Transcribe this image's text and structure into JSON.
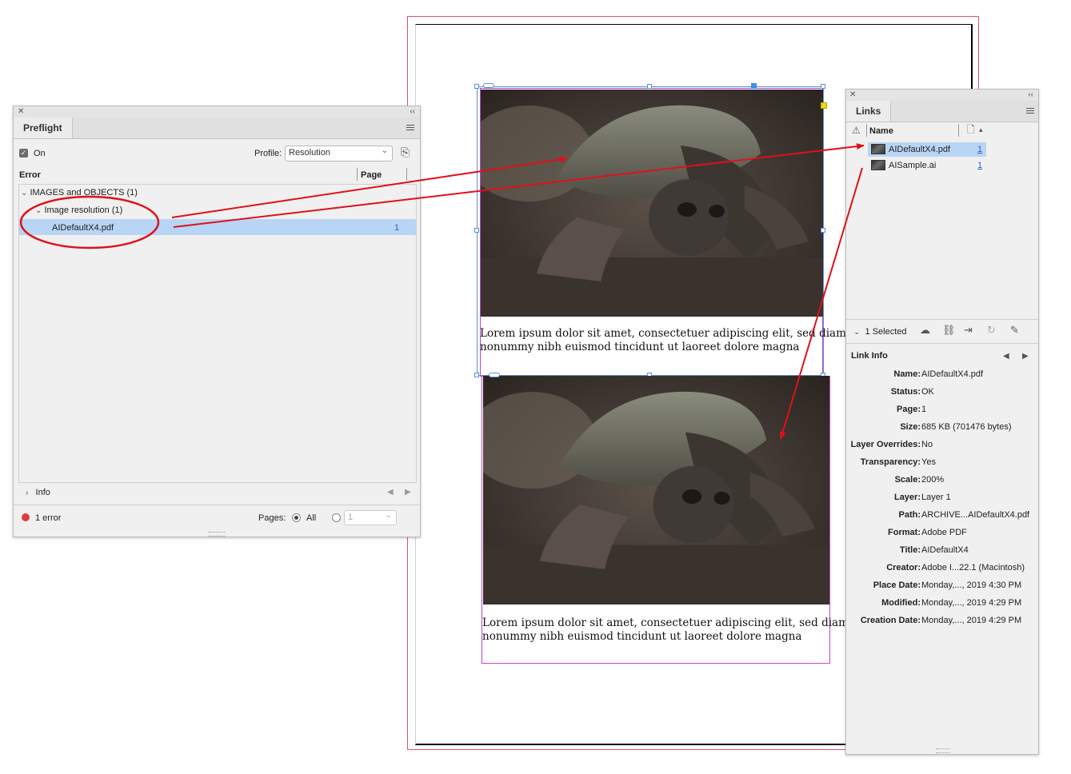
{
  "document": {
    "captions": [
      {
        "line1": "Lorem ipsum dolor sit amet, consectetuer adipiscing elit, sed diam",
        "line2": "nonummy nibh euismod tincidunt ut laoreet dolore magna"
      },
      {
        "line1": "Lorem ipsum dolor sit amet, consectetuer adipiscing elit, sed diam",
        "line2": "nonummy nibh euismod tincidunt ut laoreet dolore magna"
      }
    ]
  },
  "preflight": {
    "tab": "Preflight",
    "on_label": "On",
    "profile_label": "Profile:",
    "profile_value": "Resolution",
    "col_error": "Error",
    "col_page": "Page",
    "group": "IMAGES and OBJECTS (1)",
    "subgroup": "Image resolution (1)",
    "item_name": "AIDefaultX4.pdf",
    "item_page": "1",
    "info_label": "Info",
    "error_count": "1 error",
    "pages_label": "Pages:",
    "pages_all": "All",
    "pages_range_value": "1"
  },
  "links": {
    "tab": "Links",
    "col_name": "Name",
    "items": [
      {
        "name": "AIDefaultX4.pdf",
        "page": "1"
      },
      {
        "name": "AISample.ai",
        "page": "1"
      }
    ],
    "selected_count": "1 Selected",
    "link_info_label": "Link Info",
    "info": [
      {
        "key": "Name:",
        "value": "AIDefaultX4.pdf"
      },
      {
        "key": "Status:",
        "value": "OK"
      },
      {
        "key": "Page:",
        "value": "1"
      },
      {
        "key": "Size:",
        "value": "685 KB (701476 bytes)"
      },
      {
        "key": "Layer Overrides:",
        "value": "No"
      },
      {
        "key": "Transparency:",
        "value": "Yes"
      },
      {
        "key": "Scale:",
        "value": "200%"
      },
      {
        "key": "Layer:",
        "value": "Layer 1"
      },
      {
        "key": "Path:",
        "value": "ARCHIVE...AIDefaultX4.pdf"
      },
      {
        "key": "Format:",
        "value": "Adobe PDF"
      },
      {
        "key": "Title:",
        "value": "AIDefaultX4"
      },
      {
        "key": "Creator:",
        "value": "Adobe I...22.1 (Macintosh)"
      },
      {
        "key": "Place Date:",
        "value": "Monday,..., 2019 4:30 PM"
      },
      {
        "key": "Modified:",
        "value": "Monday,..., 2019 4:29 PM"
      },
      {
        "key": "Creation Date:",
        "value": "Monday,..., 2019 4:29 PM"
      }
    ]
  },
  "colors": {
    "annotation_red": "#e0101a",
    "selection_blue": "#b9d5f5",
    "frame_blue": "#5b8fd6",
    "frame_magenta": "#c044c8",
    "bleed_red": "#e0506a"
  }
}
